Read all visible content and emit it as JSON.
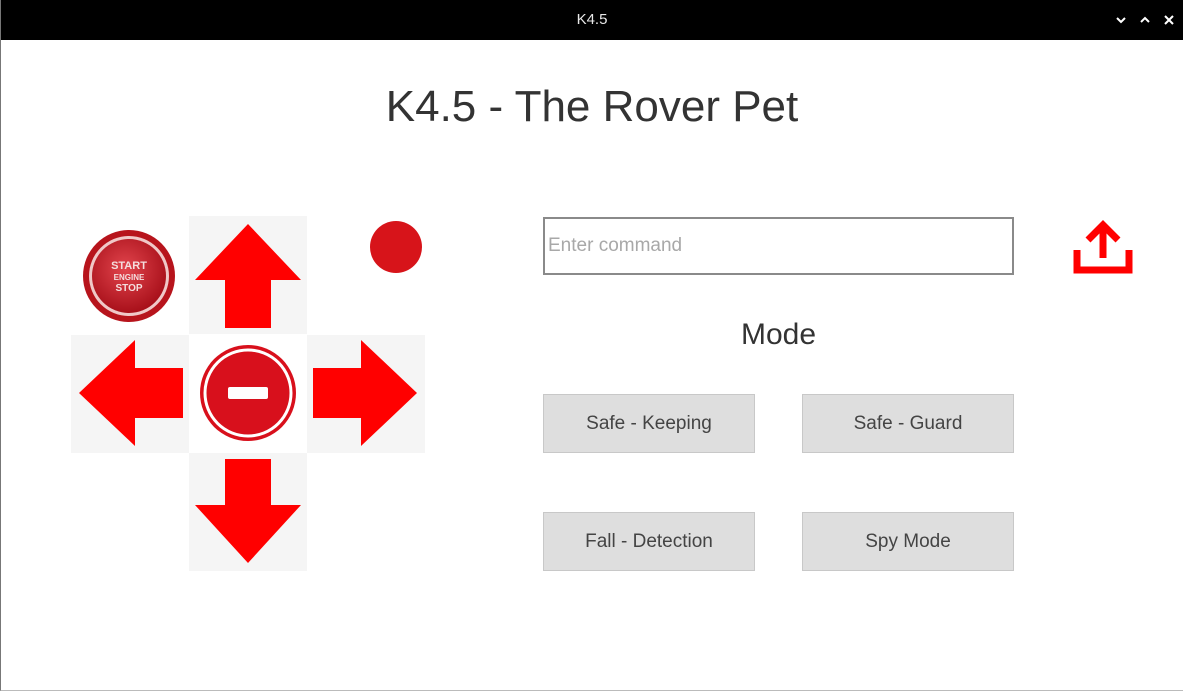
{
  "window": {
    "title": "K4.5",
    "controls": {
      "minimize_icon": "chevron-down-icon",
      "maximize_icon": "chevron-up-icon",
      "close_icon": "close-icon"
    }
  },
  "header": {
    "title": "K4.5 - The Rover Pet"
  },
  "controls": {
    "start_button": {
      "line1": "START",
      "line2": "ENGINE",
      "line3": "STOP"
    },
    "status_indicator_color": "#d7141a",
    "arrow_color": "#ff0000",
    "stop_button_color": "#d8101c"
  },
  "command": {
    "placeholder": "Enter command",
    "value": "",
    "send_icon": "upload-icon"
  },
  "modes": {
    "label": "Mode",
    "buttons": [
      {
        "label": "Safe - Keeping"
      },
      {
        "label": "Safe - Guard"
      },
      {
        "label": "Fall - Detection"
      },
      {
        "label": "Spy Mode"
      }
    ]
  }
}
